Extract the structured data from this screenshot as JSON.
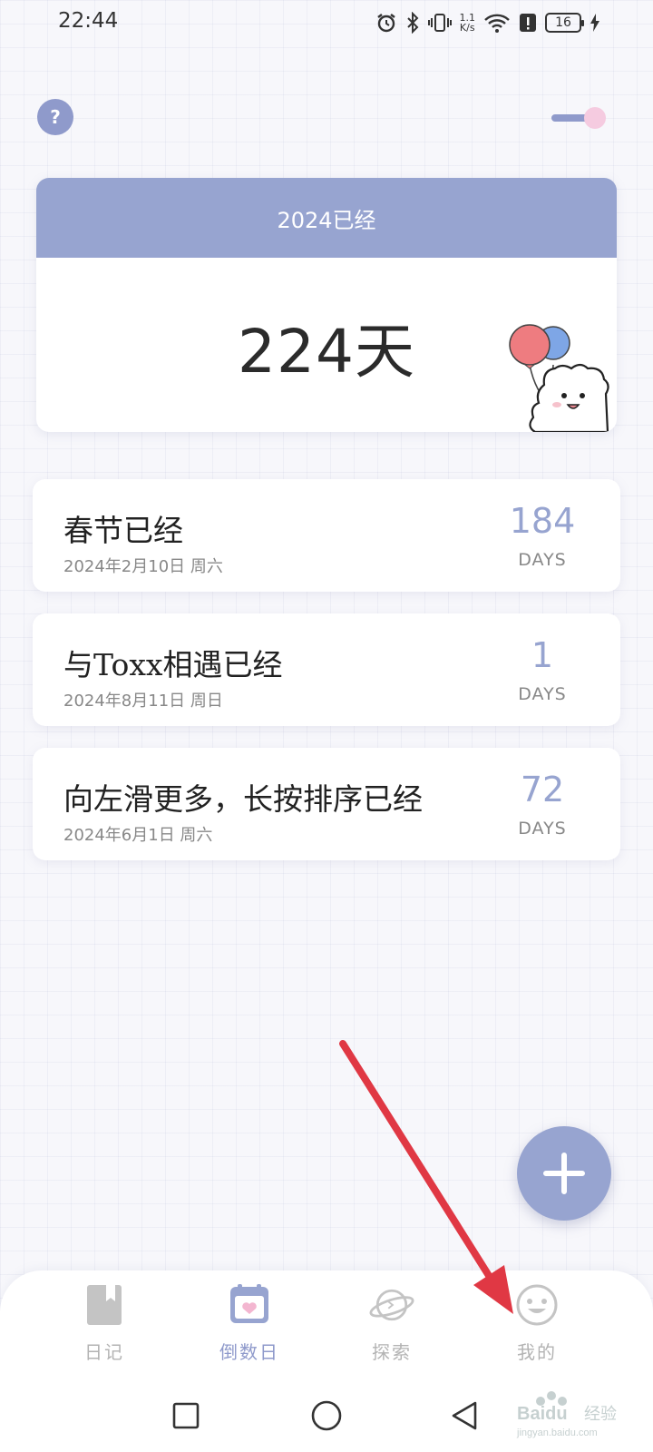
{
  "status_bar": {
    "time": "22:44",
    "net_speed_value": "1.1",
    "net_speed_unit": "K/s",
    "battery": "16"
  },
  "main_card": {
    "title": "2024已经",
    "value": "224天"
  },
  "events": [
    {
      "name": "春节已经",
      "date": "2024年2月10日 周六",
      "count": "184",
      "unit": "DAYS"
    },
    {
      "name": "与Toxx相遇已经",
      "date": "2024年8月11日 周日",
      "count": "1",
      "unit": "DAYS"
    },
    {
      "name": "向左滑更多，长按排序已经",
      "date": "2024年6月1日 周六",
      "count": "72",
      "unit": "DAYS"
    }
  ],
  "tabs": [
    {
      "label": "日记",
      "icon": "diary-book-icon",
      "active": false
    },
    {
      "label": "倒数日",
      "icon": "calendar-heart-icon",
      "active": true
    },
    {
      "label": "探索",
      "icon": "planet-icon",
      "active": false
    },
    {
      "label": "我的",
      "icon": "smiley-face-icon",
      "active": false
    }
  ],
  "colors": {
    "accent": "#97a4d0",
    "accent_dark": "#8f9acb",
    "annotation_arrow": "#e03844",
    "toggle_knob": "#f5cbe0"
  },
  "watermark": {
    "brand": "Baidu",
    "brand_cn": "经验",
    "url": "jingyan.baidu.com"
  }
}
